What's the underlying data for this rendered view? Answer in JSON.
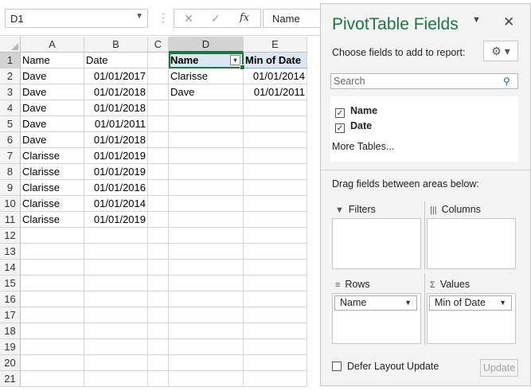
{
  "formula_bar": {
    "name_box": "D1",
    "separator": "⋮",
    "cancel": "✕",
    "enter": "✓",
    "fx": "fx",
    "content": "Name"
  },
  "columns": [
    "A",
    "B",
    "C",
    "D",
    "E"
  ],
  "rows": [
    "1",
    "2",
    "3",
    "4",
    "5",
    "6",
    "7",
    "8",
    "9",
    "10",
    "11",
    "12",
    "13",
    "14",
    "15",
    "16",
    "17",
    "18",
    "19",
    "20",
    "21"
  ],
  "sheet": {
    "table": [
      [
        "Name",
        "Date"
      ],
      [
        "Dave",
        "01/01/2017"
      ],
      [
        "Dave",
        "01/01/2018"
      ],
      [
        "Dave",
        "01/01/2018"
      ],
      [
        "Dave",
        "01/01/2011"
      ],
      [
        "Dave",
        "01/01/2018"
      ],
      [
        "Clarisse",
        "01/01/2019"
      ],
      [
        "Clarisse",
        "01/01/2019"
      ],
      [
        "Clarisse",
        "01/01/2016"
      ],
      [
        "Clarisse",
        "01/01/2014"
      ],
      [
        "Clarisse",
        "01/01/2019"
      ]
    ],
    "pivot": [
      [
        "Name",
        "Min of Date"
      ],
      [
        "Clarisse",
        "01/01/2014"
      ],
      [
        "Dave",
        "01/01/2011"
      ]
    ]
  },
  "pane": {
    "title": "PivotTable Fields",
    "dropdown_glyph": "▼",
    "close_glyph": "✕",
    "choose_label": "Choose fields to add to report:",
    "settings_glyph": "⚙ ▾",
    "search_placeholder": "Search",
    "fields": [
      {
        "label": "Name",
        "checked": "✓"
      },
      {
        "label": "Date",
        "checked": "✓"
      }
    ],
    "more_tables": "More Tables...",
    "drag_label": "Drag fields between areas below:",
    "areas": {
      "filters": {
        "label": "Filters",
        "icon": "▼"
      },
      "columns": {
        "label": "Columns",
        "icon": "|||"
      },
      "rows": {
        "label": "Rows",
        "icon": "≡",
        "item": "Name"
      },
      "values": {
        "label": "Values",
        "icon": "Σ",
        "item": "Min of Date"
      }
    },
    "pill_dropdown": "▼",
    "defer_label": "Defer Layout Update",
    "update_label": "Update"
  },
  "colors": {
    "accent": "#217346",
    "pivot_header_fill": "#dce6f1"
  }
}
